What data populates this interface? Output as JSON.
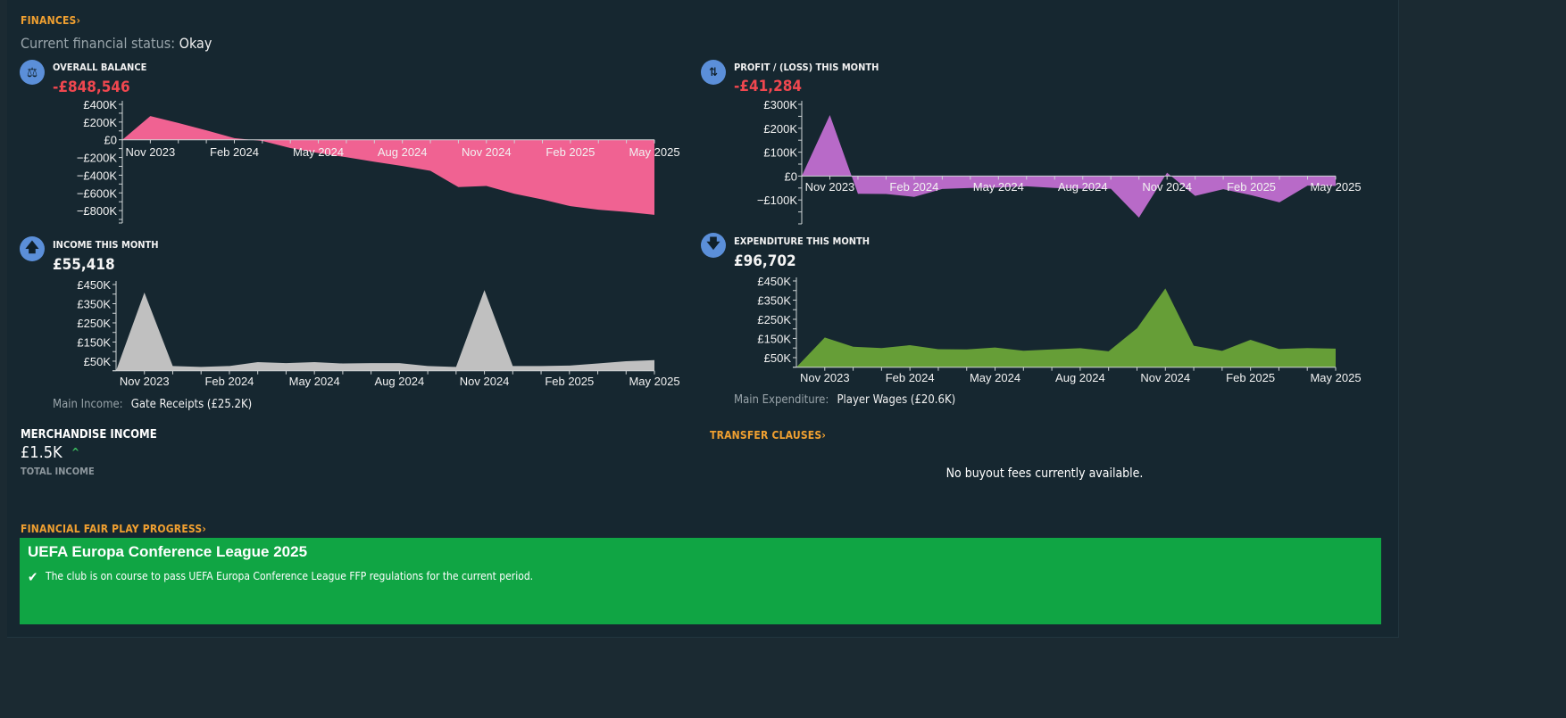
{
  "header": {
    "title": "FINANCES",
    "status_label": "Current financial status:",
    "status_value": "Okay"
  },
  "overall_balance": {
    "title": "OVERALL BALANCE",
    "value": "-£848,546",
    "icon": "balance-scale-icon"
  },
  "profit": {
    "title": "PROFIT / (LOSS) THIS MONTH",
    "value": "-£41,284",
    "icon": "profit-loss-icon"
  },
  "income": {
    "title": "INCOME THIS MONTH",
    "value": "£55,418",
    "icon": "arrow-up-icon",
    "main_label": "Main Income:",
    "main_value": "Gate Receipts (£25.2K)"
  },
  "expenditure": {
    "title": "EXPENDITURE THIS MONTH",
    "value": "£96,702",
    "icon": "arrow-down-icon",
    "main_label": "Main Expenditure:",
    "main_value": "Player Wages (£20.6K)"
  },
  "merchandise": {
    "title": "MERCHANDISE INCOME",
    "value": "£1.5K",
    "trend": "up",
    "subtitle": "TOTAL INCOME"
  },
  "transfer_clauses": {
    "title": "TRANSFER CLAUSES",
    "message": "No buyout fees currently available."
  },
  "ffp": {
    "title": "FINANCIAL FAIR PLAY PROGRESS",
    "competition": "UEFA Europa Conference League 2025",
    "message": "The club is on course to pass UEFA Europa Conference League FFP regulations for the current period.",
    "color": "#10a544"
  },
  "colors": {
    "accent": "#f0a030",
    "negative": "#f0474f",
    "icon_bg": "#5b8fd9",
    "background": "#162730"
  },
  "chart_data": [
    {
      "id": "balance",
      "type": "area",
      "color": "#f06292",
      "x": [
        "Oct 2023",
        "Nov 2023",
        "Dec 2023",
        "Jan 2024",
        "Feb 2024",
        "Mar 2024",
        "Apr 2024",
        "May 2024",
        "Jun 2024",
        "Jul 2024",
        "Aug 2024",
        "Sep 2024",
        "Oct 2024",
        "Nov 2024",
        "Dec 2024",
        "Jan 2025",
        "Feb 2025",
        "Mar 2025",
        "Apr 2025",
        "May 2025"
      ],
      "values": [
        0,
        268000,
        190000,
        106000,
        19000,
        -13000,
        -94000,
        -150000,
        -197000,
        -248000,
        -297000,
        -350000,
        -535000,
        -522000,
        -610000,
        -674000,
        -750000,
        -790000,
        -815000,
        -848546
      ],
      "xtick_labels": [
        "Nov 2023",
        "Feb 2024",
        "May 2024",
        "Aug 2024",
        "Nov 2024",
        "Feb 2025",
        "May 2025"
      ],
      "ytick_labels": [
        "£400K",
        "£200K",
        "£0",
        "−£200K",
        "−£400K",
        "−£600K",
        "−£800K"
      ],
      "yticks": [
        400000,
        200000,
        0,
        -200000,
        -400000,
        -600000,
        -800000
      ],
      "ylim": [
        -940000,
        400000
      ]
    },
    {
      "id": "profit",
      "type": "area",
      "color": "#b86ac8",
      "x": [
        "Oct 2023",
        "Nov 2023",
        "Dec 2023",
        "Jan 2024",
        "Feb 2024",
        "Mar 2024",
        "Apr 2024",
        "May 2024",
        "Jun 2024",
        "Jul 2024",
        "Aug 2024",
        "Sep 2024",
        "Oct 2024",
        "Nov 2024",
        "Dec 2024",
        "Jan 2025",
        "Feb 2025",
        "Mar 2025",
        "Apr 2025",
        "May 2025"
      ],
      "values": [
        0,
        255000,
        -74000,
        -75000,
        -87000,
        -54000,
        -50000,
        -48000,
        -43000,
        -50000,
        -53000,
        -53000,
        -174000,
        14000,
        -83000,
        -55000,
        -80000,
        -110000,
        -40000,
        -41284
      ],
      "xtick_labels": [
        "Nov 2023",
        "Feb 2024",
        "May 2024",
        "Aug 2024",
        "Nov 2024",
        "Feb 2025",
        "May 2025"
      ],
      "ytick_labels": [
        "£300K",
        "£200K",
        "£100K",
        "£0",
        "−£100K"
      ],
      "yticks": [
        300000,
        200000,
        100000,
        0,
        -100000
      ],
      "ylim": [
        -200000,
        300000
      ]
    },
    {
      "id": "income",
      "type": "area",
      "color": "#c0c0c0",
      "x": [
        "Oct 2023",
        "Nov 2023",
        "Dec 2023",
        "Jan 2024",
        "Feb 2024",
        "Mar 2024",
        "Apr 2024",
        "May 2024",
        "Jun 2024",
        "Jul 2024",
        "Aug 2024",
        "Sep 2024",
        "Oct 2024",
        "Nov 2024",
        "Dec 2024",
        "Jan 2025",
        "Feb 2025",
        "Mar 2025",
        "Apr 2025",
        "May 2025"
      ],
      "values": [
        0,
        408000,
        25000,
        20000,
        25000,
        45000,
        40000,
        45000,
        38000,
        40000,
        40000,
        25000,
        20000,
        421000,
        25000,
        25000,
        27000,
        38000,
        50000,
        55418
      ],
      "xtick_labels": [
        "Nov 2023",
        "Feb 2024",
        "May 2024",
        "Aug 2024",
        "Nov 2024",
        "Feb 2025",
        "May 2025"
      ],
      "ytick_labels": [
        "£450K",
        "£350K",
        "£250K",
        "£150K",
        "£50K"
      ],
      "yticks": [
        450000,
        350000,
        250000,
        150000,
        50000
      ],
      "ylim": [
        0,
        450000
      ]
    },
    {
      "id": "expenditure",
      "type": "area",
      "color": "#669e37",
      "x": [
        "Oct 2023",
        "Nov 2023",
        "Dec 2023",
        "Jan 2024",
        "Feb 2024",
        "Mar 2024",
        "Apr 2024",
        "May 2024",
        "Jun 2024",
        "Jul 2024",
        "Aug 2024",
        "Sep 2024",
        "Oct 2024",
        "Nov 2024",
        "Dec 2024",
        "Jan 2025",
        "Feb 2025",
        "Mar 2025",
        "Apr 2025",
        "May 2025"
      ],
      "values": [
        0,
        155000,
        107000,
        100000,
        115000,
        94000,
        93000,
        103000,
        86000,
        93000,
        99000,
        83000,
        203000,
        411000,
        112000,
        85000,
        143000,
        95000,
        100000,
        96702
      ],
      "xtick_labels": [
        "Nov 2023",
        "Feb 2024",
        "May 2024",
        "Aug 2024",
        "Nov 2024",
        "Feb 2025",
        "May 2025"
      ],
      "ytick_labels": [
        "£450K",
        "£350K",
        "£250K",
        "£150K",
        "£50K"
      ],
      "yticks": [
        450000,
        350000,
        250000,
        150000,
        50000
      ],
      "ylim": [
        0,
        450000
      ]
    }
  ]
}
